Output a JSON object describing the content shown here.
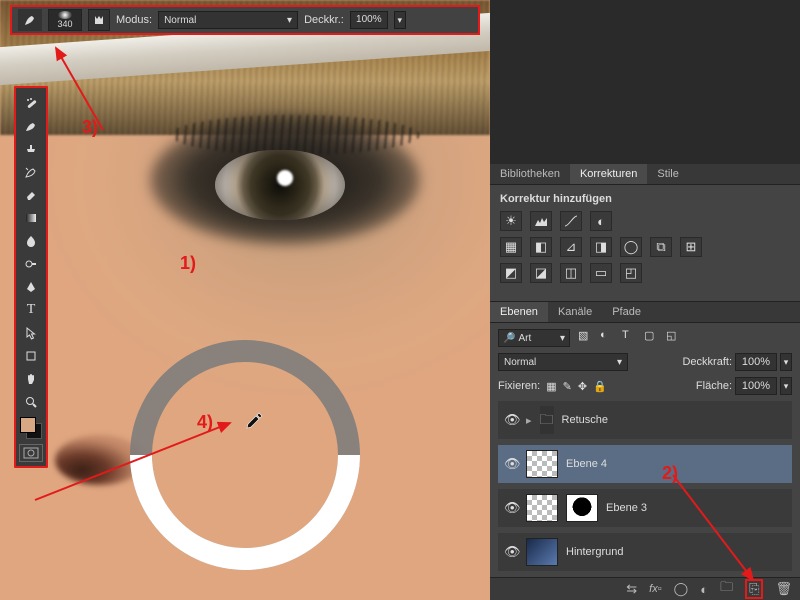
{
  "options_bar": {
    "brush_size": "340",
    "mode_label": "Modus:",
    "mode_value": "Normal",
    "opacity_label": "Deckkr.:",
    "opacity_value": "100%"
  },
  "tools": [
    "heal-brush",
    "brush",
    "stamp",
    "history-brush",
    "eraser",
    "gradient",
    "blur",
    "dodge",
    "pen",
    "type",
    "arrow",
    "path-select",
    "hand",
    "zoom"
  ],
  "panels": {
    "tabs1": [
      "Bibliotheken",
      "Korrekturen",
      "Stile"
    ],
    "adjust_title": "Korrektur hinzufügen",
    "tabs2": [
      "Ebenen",
      "Kanäle",
      "Pfade"
    ]
  },
  "layers_panel": {
    "filter_label": "Art",
    "blend_mode": "Normal",
    "opacity_label": "Deckkraft:",
    "opacity_value": "100%",
    "lock_label": "Fixieren:",
    "fill_label": "Fläche:",
    "fill_value": "100%",
    "items": [
      {
        "name": "Retusche",
        "kind": "group"
      },
      {
        "name": "Ebene 4",
        "kind": "layer",
        "selected": true,
        "trans": true
      },
      {
        "name": "Ebene 3",
        "kind": "layer",
        "trans": true,
        "mask": true
      },
      {
        "name": "Hintergrund",
        "kind": "bg"
      }
    ]
  },
  "annotations": {
    "a1": "1)",
    "a2": "2)",
    "a3": "3)",
    "a4": "4)"
  }
}
